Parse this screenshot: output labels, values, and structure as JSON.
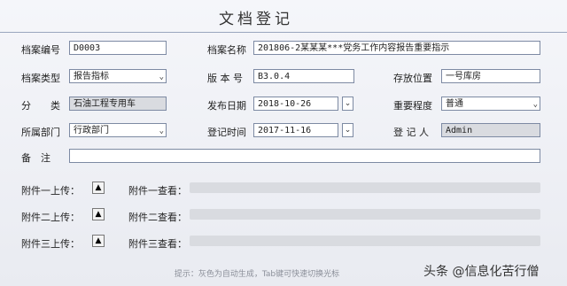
{
  "title": "文档登记",
  "fields": {
    "doc_no": {
      "label": "档案编号",
      "value": "D0003"
    },
    "doc_name": {
      "label": "档案名称",
      "value": "201806-2某某某***党务工作内容报告重要指示"
    },
    "doc_type": {
      "label": "档案类型",
      "value": "报告指标"
    },
    "version": {
      "label": "版 本 号",
      "value": "B3.0.4"
    },
    "location": {
      "label": "存放位置",
      "value": "一号库房"
    },
    "category": {
      "label": "分　　类",
      "value": "石油工程专用车"
    },
    "publish_date": {
      "label": "发布日期",
      "value": "2018-10-26"
    },
    "importance": {
      "label": "重要程度",
      "value": "普通"
    },
    "department": {
      "label": "所属部门",
      "value": "行政部门"
    },
    "register_time": {
      "label": "登记时间",
      "value": "2017-11-16"
    },
    "registrant": {
      "label": "登 记 人",
      "value": "Admin"
    },
    "remark": {
      "label": "备　注",
      "value": ""
    }
  },
  "attachments": [
    {
      "upload_label": "附件一上传：",
      "view_label": "附件一查看："
    },
    {
      "upload_label": "附件二上传：",
      "view_label": "附件二查看："
    },
    {
      "upload_label": "附件三上传：",
      "view_label": "附件三查看："
    }
  ],
  "icons": {
    "dropdown": "chevron-down-icon",
    "upload": "triangle-up-icon"
  },
  "hint": "提示：灰色为自动生成，Tab键可快速切换光标",
  "watermark": "头条 @信息化苦行僧"
}
